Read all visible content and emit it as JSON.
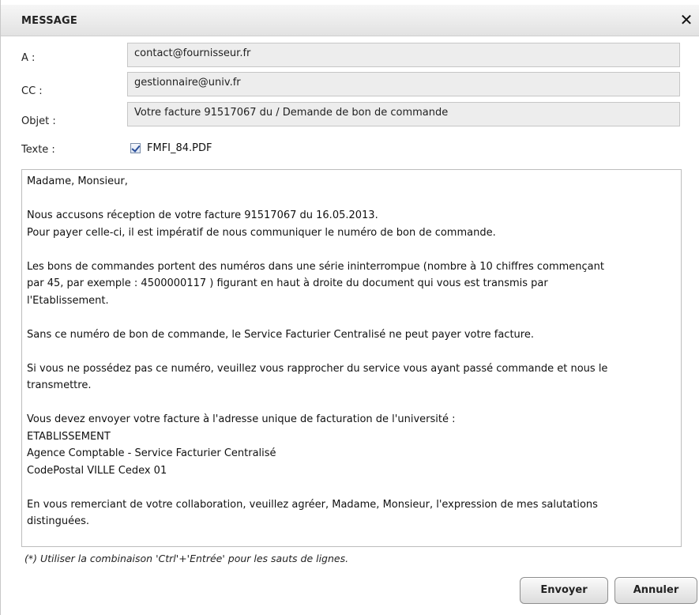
{
  "dialog": {
    "title": "MESSAGE",
    "close_glyph": "✕"
  },
  "fields": {
    "to_label": "A :",
    "to_value": "contact@fournisseur.fr",
    "cc_label": "CC :",
    "cc_value": "gestionnaire@univ.fr",
    "subject_label": "Objet :",
    "subject_value": "Votre facture 91517067 du  / Demande de bon de commande",
    "text_label": "Texte :"
  },
  "attachment": {
    "checked": true,
    "filename": "FMFI_84.PDF"
  },
  "body": {
    "l1": "Madame, Monsieur,",
    "l2": "Nous accusons réception de votre facture 91517067 du 16.05.2013.",
    "l3": "Pour payer celle-ci, il est impératif de nous communiquer le numéro de bon de commande.",
    "l4": "Les bons de commandes portent des numéros dans une série ininterrompue (nombre à 10 chiffres commençant",
    "l5": "par 45, par exemple : 4500000117 ) figurant en haut à droite du document qui vous est transmis par",
    "l6": "l'Etablissement.",
    "l7": "Sans ce numéro de bon de commande, le Service Facturier Centralisé ne peut payer votre facture.",
    "l8": "Si vous ne possédez pas ce numéro, veuillez vous rapprocher du service vous ayant passé commande et nous le",
    "l9": "transmettre.",
    "l10": "Vous devez envoyer votre facture à l'adresse unique de facturation de l'université :",
    "l11": "ETABLISSEMENT",
    "l12": "Agence Comptable - Service Facturier Centralisé",
    "l13": "CodePostal VILLE Cedex 01",
    "l14": "En vous remerciant de votre collaboration, veuillez agréer, Madame, Monsieur, l'expression de mes salutations",
    "l15": "distinguées."
  },
  "hint": "(*) Utiliser la combinaison 'Ctrl'+'Entrée' pour les sauts de lignes.",
  "buttons": {
    "send": "Envoyer",
    "cancel": "Annuler"
  }
}
